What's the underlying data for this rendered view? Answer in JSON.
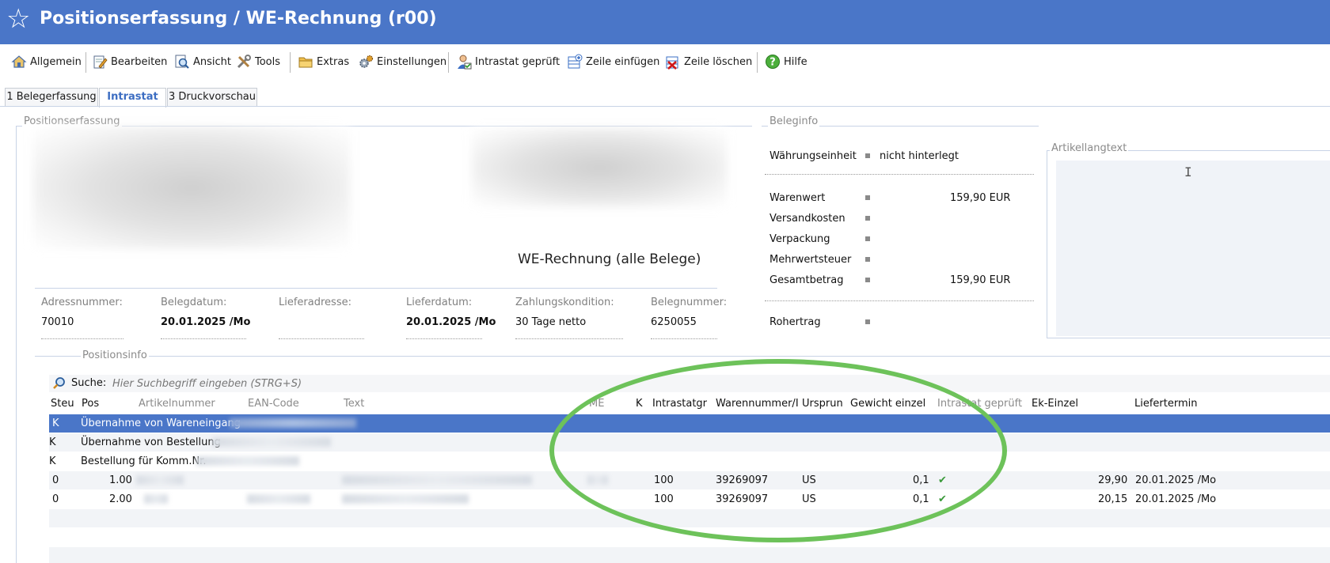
{
  "window": {
    "title": "Positionserfassung / WE-Rechnung (r00)"
  },
  "toolbar": [
    {
      "label": "Allgemein",
      "icon": "home-icon"
    },
    {
      "label": "Bearbeiten",
      "icon": "edit-icon"
    },
    {
      "label": "Ansicht",
      "icon": "view-icon"
    },
    {
      "label": "Tools",
      "icon": "tools-icon"
    },
    {
      "label": "Extras",
      "icon": "folder-icon"
    },
    {
      "label": "Einstellungen",
      "icon": "gears-icon"
    },
    {
      "label": "Intrastat geprüft",
      "icon": "user-check-icon"
    },
    {
      "label": "Zeile einfügen",
      "icon": "insert-row-icon"
    },
    {
      "label": "Zeile löschen",
      "icon": "delete-row-icon"
    },
    {
      "label": "Hilfe",
      "icon": "help-icon"
    }
  ],
  "tabs": [
    {
      "label": "1 Belegerfassung"
    },
    {
      "label": "Intrastat"
    },
    {
      "label": "3 Druckvorschau"
    }
  ],
  "sections": {
    "positionserfassung": "Positionserfassung",
    "beleginfo": "Beleginfo",
    "artikellangtext": "Artikellangtext",
    "positionsinfo": "Positionsinfo"
  },
  "document": {
    "type_label": "WE-Rechnung (alle Belege)"
  },
  "header_fields": [
    {
      "label": "Adressnummer:",
      "value": "70010"
    },
    {
      "label": "Belegdatum:",
      "value": "20.01.2025 /Mo"
    },
    {
      "label": "Lieferadresse:",
      "value": ""
    },
    {
      "label": "Lieferdatum:",
      "value": "20.01.2025 /Mo"
    },
    {
      "label": "Zahlungskondition:",
      "value": "30 Tage netto"
    },
    {
      "label": "Belegnummer:",
      "value": "6250055"
    }
  ],
  "beleginfo": {
    "waehrungseinheit": {
      "label": "Währungseinheit",
      "value": "nicht hinterlegt"
    },
    "rows": [
      {
        "label": "Warenwert",
        "value": "159,90 EUR"
      },
      {
        "label": "Versandkosten",
        "value": ""
      },
      {
        "label": "Verpackung",
        "value": ""
      },
      {
        "label": "Mehrwertsteuer",
        "value": ""
      },
      {
        "label": "Gesamtbetrag",
        "value": "159,90 EUR"
      }
    ],
    "rohertrag": {
      "label": "Rohertrag",
      "value": ""
    }
  },
  "search": {
    "label": "Suche:",
    "placeholder": "Hier Suchbegriff eingeben (STRG+S)"
  },
  "grid": {
    "columns": [
      "Steu",
      "Pos",
      "Artikelnummer",
      "EAN-Code",
      "Text",
      "ME",
      "K",
      "Intrastatgr",
      "Warennummer/I",
      "Ursprun",
      "Gewicht einzel",
      "Intrastat geprüft",
      "Ek-Einzel",
      "Liefertermin"
    ],
    "rows": [
      {
        "steu": "K",
        "pos": "",
        "text": "Übernahme von Wareneingang",
        "intrastatgr": "",
        "warennummer": "",
        "ursprung": "",
        "gewicht": "",
        "geprueft": "",
        "ek": "",
        "liefertermin": ""
      },
      {
        "steu": "K",
        "pos": "",
        "text": "Übernahme von Bestellung",
        "intrastatgr": "",
        "warennummer": "",
        "ursprung": "",
        "gewicht": "",
        "geprueft": "",
        "ek": "",
        "liefertermin": ""
      },
      {
        "steu": "K",
        "pos": "",
        "text": "Bestellung für Komm.Nr.",
        "intrastatgr": "",
        "warennummer": "",
        "ursprung": "",
        "gewicht": "",
        "geprueft": "",
        "ek": "",
        "liefertermin": ""
      },
      {
        "steu": "0",
        "pos": "1.00",
        "text": "",
        "intrastatgr": "100",
        "warennummer": "39269097",
        "ursprung": "US",
        "gewicht": "0,1",
        "geprueft": "✔",
        "ek": "29,90",
        "liefertermin": "20.01.2025 /Mo"
      },
      {
        "steu": "0",
        "pos": "2.00",
        "text": "",
        "intrastatgr": "100",
        "warennummer": "39269097",
        "ursprung": "US",
        "gewicht": "0,1",
        "geprueft": "✔",
        "ek": "20,15",
        "liefertermin": "20.01.2025 /Mo"
      }
    ]
  },
  "colors": {
    "titlebar": "#4a76c8",
    "selection": "#4a76c8",
    "highlight_ellipse": "#6dc25a",
    "active_tab": "#3c6dc2"
  }
}
